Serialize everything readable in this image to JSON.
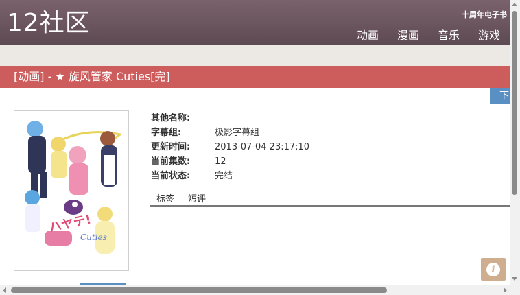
{
  "header": {
    "logo": "12社区",
    "anniversary": "十周年电子书",
    "nav": [
      "动画",
      "漫画",
      "音乐",
      "游戏"
    ]
  },
  "title_bar": "[动画] - ★ 旋风管家 Cuties[完]",
  "download_tab": "下",
  "cover": {
    "alt": "Hayate no Gotoku! Cuties cover",
    "logo_text": "ハヤテのごとく! Cuties"
  },
  "info": [
    {
      "label": "其他名称:",
      "value": ""
    },
    {
      "label": "字幕组:",
      "value": "极影字幕组"
    },
    {
      "label": "更新时间:",
      "value": "2013-07-04 23:17:10"
    },
    {
      "label": "当前集数:",
      "value": "12"
    },
    {
      "label": "当前状态:",
      "value": "完结"
    }
  ],
  "tabs": [
    "标签",
    "短评"
  ],
  "info_button_icon": "info-icon",
  "colors": {
    "header": "#6e5a62",
    "title_bar": "#cd5c5c",
    "band": "#ece8e4",
    "accent_blue": "#5a8fc4",
    "info_button": "#cfae8f"
  }
}
